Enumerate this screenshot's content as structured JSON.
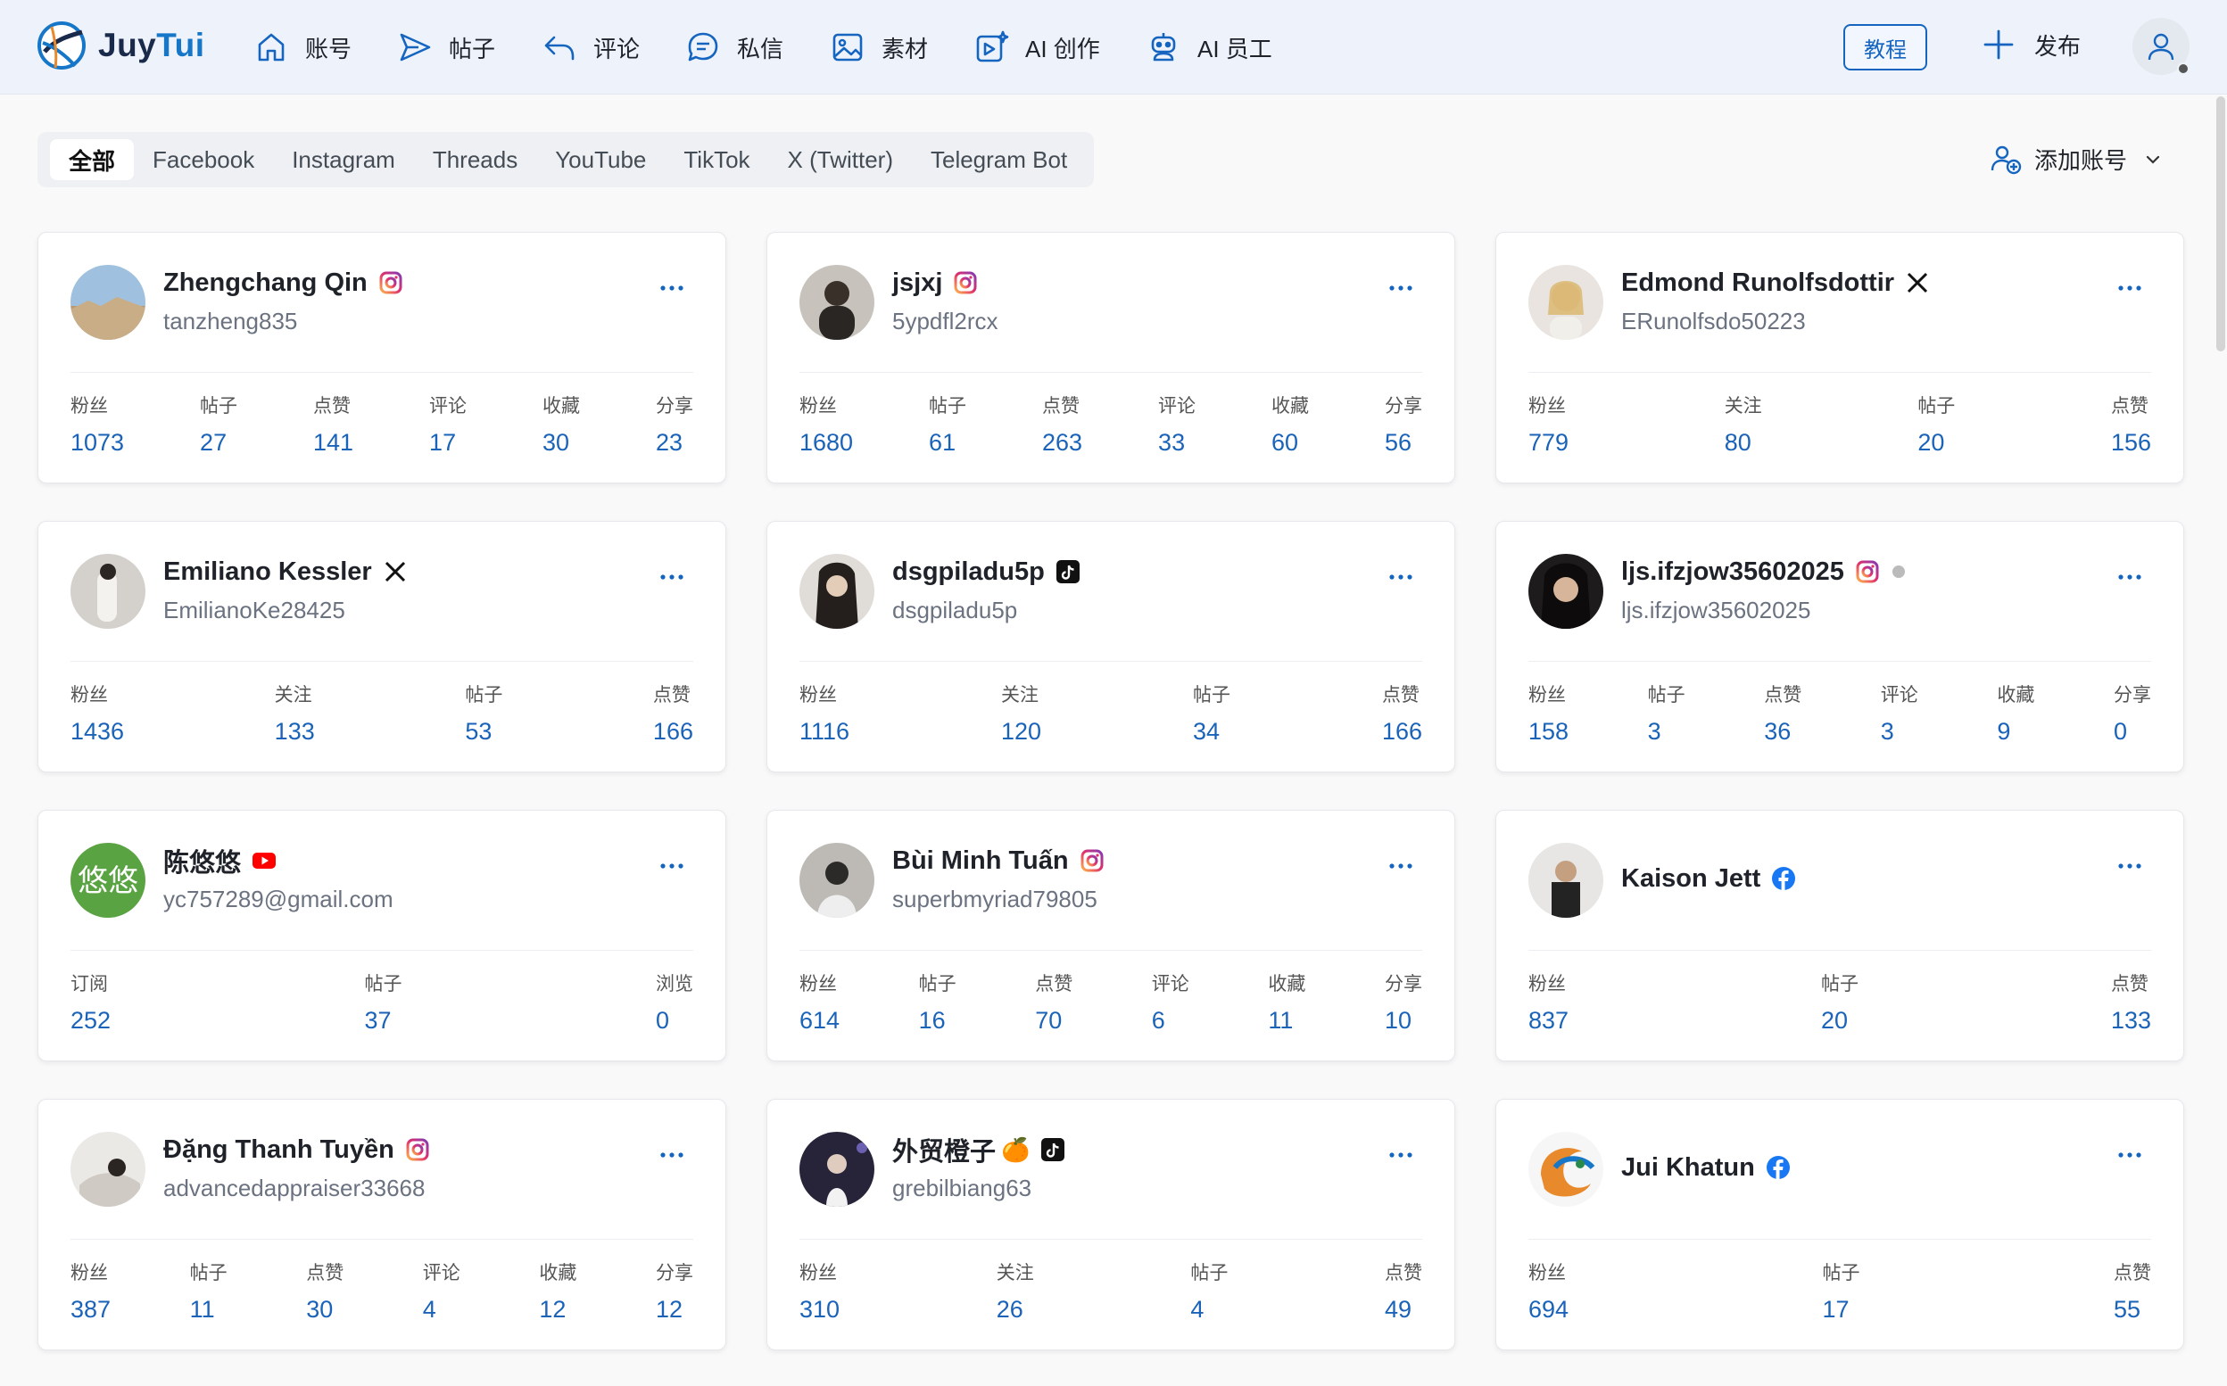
{
  "app": {
    "logo_part1": "Juy",
    "logo_part2": "Tui"
  },
  "nav": [
    {
      "label": "账号",
      "icon": "home-icon"
    },
    {
      "label": "帖子",
      "icon": "send-icon"
    },
    {
      "label": "评论",
      "icon": "reply-icon"
    },
    {
      "label": "私信",
      "icon": "message-icon"
    },
    {
      "label": "素材",
      "icon": "image-icon"
    },
    {
      "label": "AI 创作",
      "icon": "ai-create-icon"
    },
    {
      "label": "AI 员工",
      "icon": "robot-icon"
    }
  ],
  "header": {
    "tutorial_label": "教程",
    "publish_label": "发布"
  },
  "filters": {
    "tabs": [
      "全部",
      "Facebook",
      "Instagram",
      "Threads",
      "YouTube",
      "TikTok",
      "X (Twitter)",
      "Telegram Bot"
    ],
    "active": "全部",
    "add_account_label": "添加账号"
  },
  "accounts": [
    {
      "name": "Zhengchang Qin",
      "handle": "tanzheng835",
      "platform": "instagram",
      "stats": [
        [
          "粉丝",
          "1073"
        ],
        [
          "帖子",
          "27"
        ],
        [
          "点赞",
          "141"
        ],
        [
          "评论",
          "17"
        ],
        [
          "收藏",
          "30"
        ],
        [
          "分享",
          "23"
        ]
      ]
    },
    {
      "name": "jsjxj",
      "handle": "5ypdfl2rcx",
      "platform": "instagram",
      "stats": [
        [
          "粉丝",
          "1680"
        ],
        [
          "帖子",
          "61"
        ],
        [
          "点赞",
          "263"
        ],
        [
          "评论",
          "33"
        ],
        [
          "收藏",
          "60"
        ],
        [
          "分享",
          "56"
        ]
      ]
    },
    {
      "name": "Edmond Runolfsdottir",
      "handle": "ERunolfsdo50223",
      "platform": "x",
      "stats": [
        [
          "粉丝",
          "779"
        ],
        [
          "关注",
          "80"
        ],
        [
          "帖子",
          "20"
        ],
        [
          "点赞",
          "156"
        ]
      ]
    },
    {
      "name": "Emiliano Kessler",
      "handle": "EmilianoKe28425",
      "platform": "x",
      "stats": [
        [
          "粉丝",
          "1436"
        ],
        [
          "关注",
          "133"
        ],
        [
          "帖子",
          "53"
        ],
        [
          "点赞",
          "166"
        ]
      ]
    },
    {
      "name": "dsgpiladu5p",
      "handle": "dsgpiladu5p",
      "platform": "tiktok",
      "stats": [
        [
          "粉丝",
          "1116"
        ],
        [
          "关注",
          "120"
        ],
        [
          "帖子",
          "34"
        ],
        [
          "点赞",
          "166"
        ]
      ]
    },
    {
      "name": "ljs.ifzjow35602025",
      "handle": "ljs.ifzjow35602025",
      "platform": "instagram",
      "status_dot": true,
      "stats": [
        [
          "粉丝",
          "158"
        ],
        [
          "帖子",
          "3"
        ],
        [
          "点赞",
          "36"
        ],
        [
          "评论",
          "3"
        ],
        [
          "收藏",
          "9"
        ],
        [
          "分享",
          "0"
        ]
      ]
    },
    {
      "name": "陈悠悠",
      "handle": "yc757289@gmail.com",
      "platform": "youtube",
      "avatar_text": "悠悠",
      "stats": [
        [
          "订阅",
          "252"
        ],
        [
          "帖子",
          "37"
        ],
        [
          "浏览",
          "0"
        ]
      ]
    },
    {
      "name": "Bùi Minh Tuấn",
      "handle": "superbmyriad79805",
      "platform": "instagram",
      "stats": [
        [
          "粉丝",
          "614"
        ],
        [
          "帖子",
          "16"
        ],
        [
          "点赞",
          "70"
        ],
        [
          "评论",
          "6"
        ],
        [
          "收藏",
          "11"
        ],
        [
          "分享",
          "10"
        ]
      ]
    },
    {
      "name": "Kaison Jett",
      "handle": "",
      "platform": "facebook",
      "stats": [
        [
          "粉丝",
          "837"
        ],
        [
          "帖子",
          "20"
        ],
        [
          "点赞",
          "133"
        ]
      ]
    },
    {
      "name": "Đặng Thanh Tuyền",
      "handle": "advancedappraiser33668",
      "platform": "instagram",
      "stats": [
        [
          "粉丝",
          "387"
        ],
        [
          "帖子",
          "11"
        ],
        [
          "点赞",
          "30"
        ],
        [
          "评论",
          "4"
        ],
        [
          "收藏",
          "12"
        ],
        [
          "分享",
          "12"
        ]
      ]
    },
    {
      "name": "外贸橙子",
      "extra": "🍊",
      "handle": "grebilbiang63",
      "platform": "tiktok",
      "stats": [
        [
          "粉丝",
          "310"
        ],
        [
          "关注",
          "26"
        ],
        [
          "帖子",
          "4"
        ],
        [
          "点赞",
          "49"
        ]
      ]
    },
    {
      "name": "Jui Khatun",
      "handle": "",
      "platform": "facebook",
      "stats": [
        [
          "粉丝",
          "694"
        ],
        [
          "帖子",
          "17"
        ],
        [
          "点赞",
          "55"
        ]
      ]
    }
  ],
  "colors": {
    "accent": "#1565c0",
    "stat_value": "#1a63b8",
    "header_bg": "#eef3fb"
  }
}
